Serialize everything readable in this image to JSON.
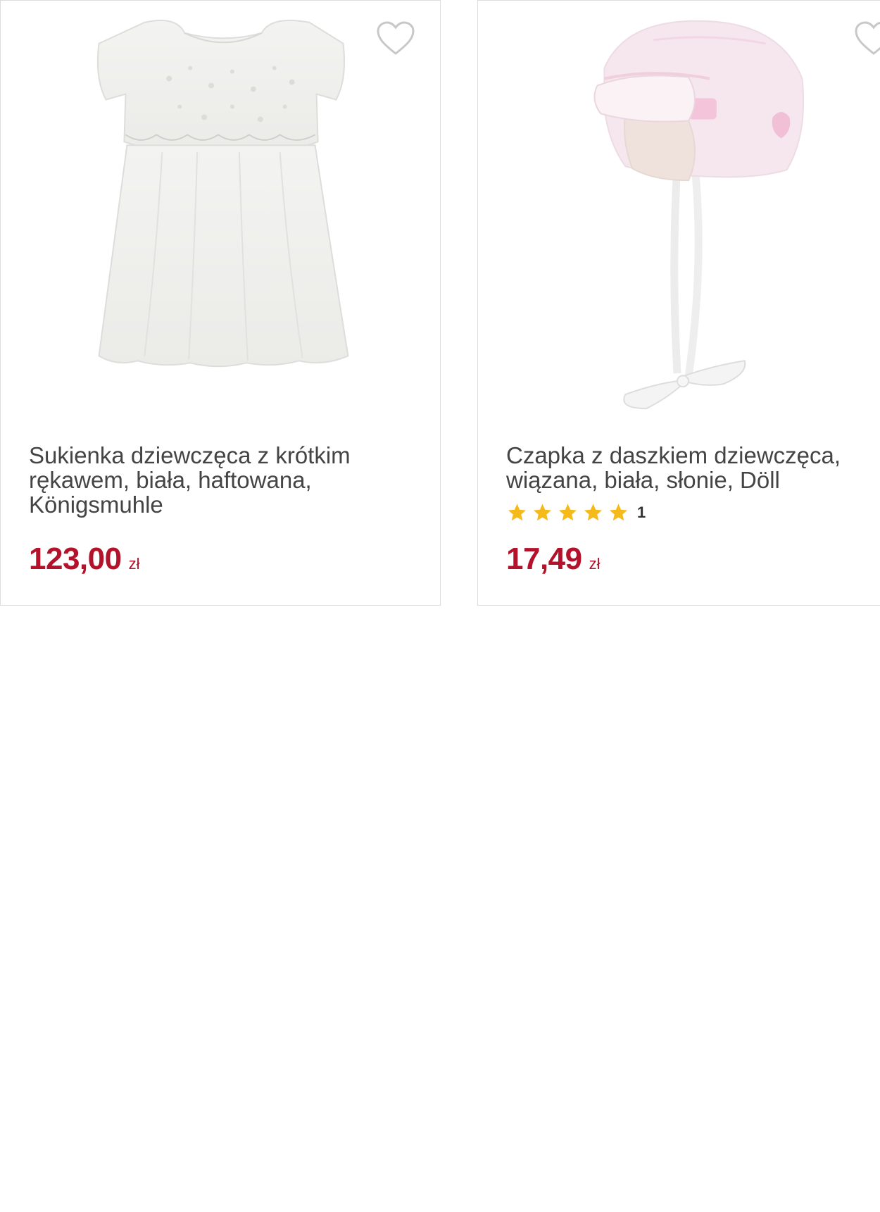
{
  "products": [
    {
      "title": "Sukienka dziewczęca z krótkim rękawem, biała, haftowana, Königsmuhle",
      "price": "123,00",
      "currency": "zł",
      "image": "white-dress-image"
    },
    {
      "title": "Czapka z daszkiem dziewczęca, wiązana, biała, słonie, Döll",
      "price": "17,49",
      "currency": "zł",
      "rating": {
        "stars": 5,
        "max": 5,
        "count": "1"
      },
      "image": "pink-cap-image"
    }
  ],
  "colors": {
    "price": "#b3122a",
    "star": "#f5b919",
    "title": "#444444",
    "border": "#dcdcdc"
  },
  "icons": {
    "favorite": "heart-outline-icon",
    "rating": "star-icon"
  }
}
